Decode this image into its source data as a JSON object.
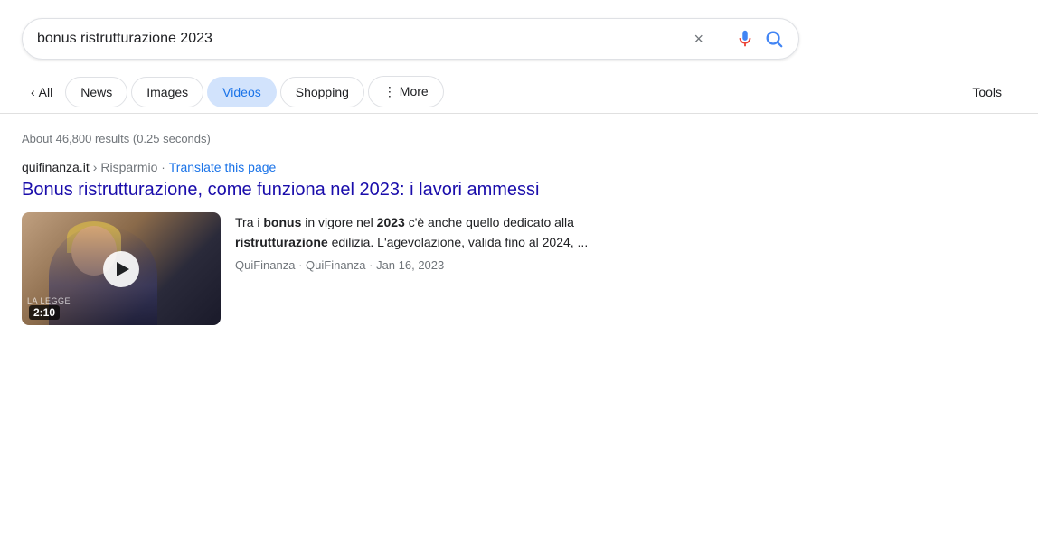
{
  "searchbar": {
    "query": "bonus ristrutturazione 2023",
    "clear_label": "×",
    "voice_label": "Voice search",
    "submit_label": "Search"
  },
  "tabs": {
    "back_label": "‹",
    "all_label": "All",
    "items": [
      {
        "id": "news",
        "label": "News",
        "active": false
      },
      {
        "id": "images",
        "label": "Images",
        "active": false
      },
      {
        "id": "videos",
        "label": "Videos",
        "active": true
      },
      {
        "id": "shopping",
        "label": "Shopping",
        "active": false
      },
      {
        "id": "more",
        "label": "⋮  More",
        "active": false
      }
    ],
    "tools_label": "Tools"
  },
  "results_info": "About 46,800 results (0.25 seconds)",
  "result": {
    "domain": "quifinanza.it",
    "separator": "›",
    "breadcrumb": "Risparmio",
    "dot": "·",
    "translate_text": "Translate this page",
    "title": "Bonus ristrutturazione, come funziona nel 2023: i lavori ammessi",
    "snippet_parts": [
      "Tra i ",
      "bonus",
      " in vigore nel ",
      "2023",
      " c'è anche quello dedicato alla ",
      "ristrutturazione",
      " edilizia. L'agevolazione, valida fino al 2024, ..."
    ],
    "meta": "QuiFinanza · QuiFinanza · Jan 16, 2023",
    "video_duration": "2:10",
    "thumbnail_watermark": "LA LEGGE"
  }
}
